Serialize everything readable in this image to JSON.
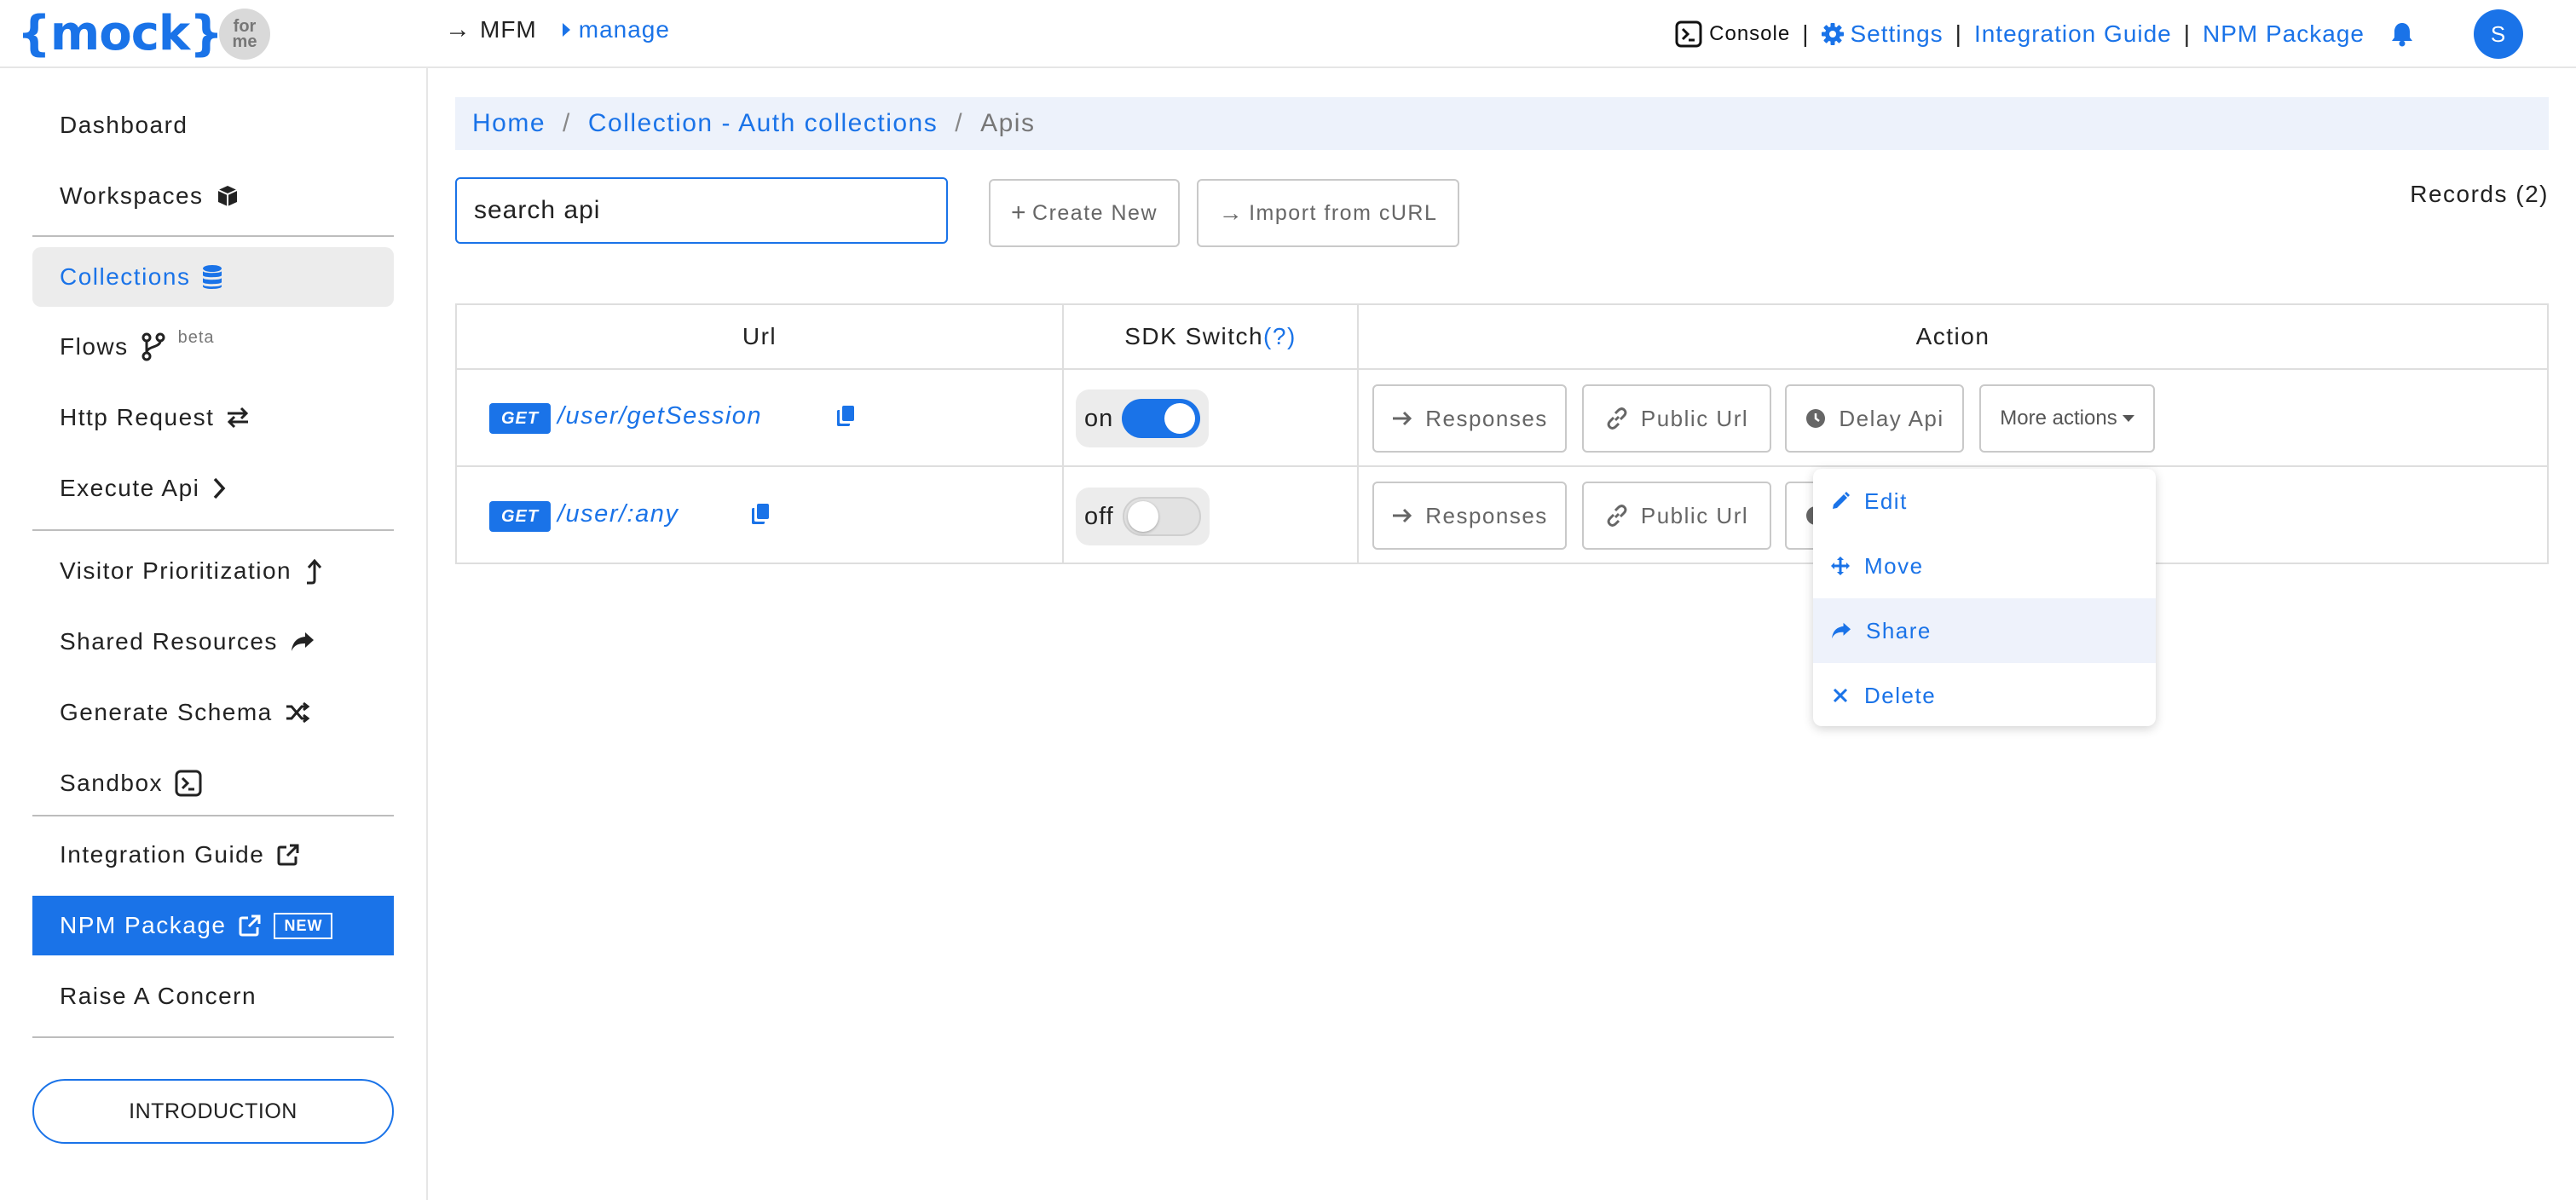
{
  "header": {
    "logo_text": "{mock}",
    "logo_badge_line1": "for",
    "logo_badge_line2": "me",
    "crumb_arrow": "→",
    "crumb_root": "MFM",
    "crumb_current": "manage",
    "console_label": "Console",
    "separator": "|",
    "settings_label": "Settings",
    "integration_guide_label": "Integration Guide",
    "npm_package_label": "NPM Package",
    "avatar_initial": "S",
    "accent_color": "#1a73e8"
  },
  "sidebar": {
    "items": [
      {
        "label": "Dashboard"
      },
      {
        "label": "Workspaces",
        "icon": "cube-icon"
      },
      {
        "label": "Collections",
        "icon": "database-icon",
        "active": true
      },
      {
        "label": "Flows",
        "icon": "branch-icon",
        "badge": "beta"
      },
      {
        "label": "Http Request",
        "icon": "exchange-icon"
      },
      {
        "label": "Execute Api",
        "icon": "chevron-right-icon"
      },
      {
        "label": "Visitor Prioritization",
        "icon": "level-up-icon"
      },
      {
        "label": "Shared Resources",
        "icon": "share-icon"
      },
      {
        "label": "Generate Schema",
        "icon": "shuffle-icon"
      },
      {
        "label": "Sandbox",
        "icon": "terminal-icon"
      },
      {
        "label": "Integration Guide",
        "icon": "external-link-icon"
      },
      {
        "label": "NPM Package",
        "icon": "external-link-icon",
        "badge": "NEW"
      },
      {
        "label": "Raise A Concern"
      }
    ],
    "intro_button": "INTRODUCTION"
  },
  "breadcrumb": {
    "home": "Home",
    "separator": "/",
    "collection": "Collection - Auth collections",
    "current": "Apis"
  },
  "toolbar": {
    "search_placeholder": "search api",
    "create_new": "Create New",
    "create_icon": "+",
    "import_curl": "Import from cURL",
    "import_icon": "→",
    "records": "Records (2)"
  },
  "table": {
    "headers": {
      "url": "Url",
      "sdk_switch": "SDK Switch",
      "sdk_help": "(?)",
      "action": "Action"
    },
    "rows": [
      {
        "method": "GET",
        "path": "/user/getSession",
        "sdk_label": "on",
        "sdk_on": true
      },
      {
        "method": "GET",
        "path": "/user/:any",
        "sdk_label": "off",
        "sdk_on": false
      }
    ],
    "actions": {
      "responses": "Responses",
      "public_url": "Public Url",
      "delay_api": "Delay Api",
      "more_actions": "More actions"
    }
  },
  "dropdown": {
    "items": [
      {
        "label": "Edit",
        "icon": "pencil-icon"
      },
      {
        "label": "Move",
        "icon": "move-icon"
      },
      {
        "label": "Share",
        "icon": "share-icon",
        "highlighted": true
      },
      {
        "label": "Delete",
        "icon": "close-icon"
      }
    ]
  }
}
